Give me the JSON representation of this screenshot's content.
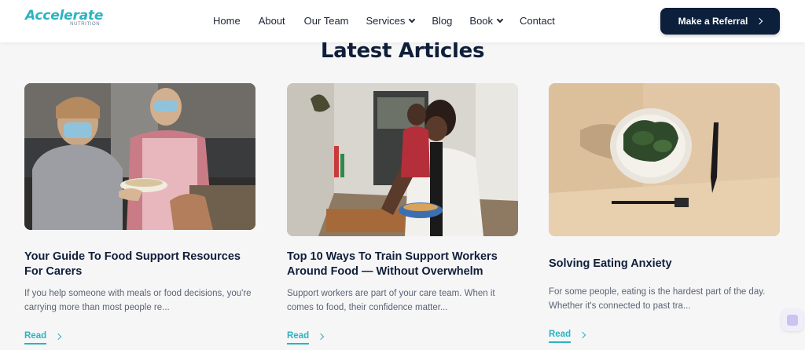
{
  "header": {
    "logo_text": "Accelerate",
    "logo_subtext": "NUTRITION",
    "nav": [
      {
        "label": "Home"
      },
      {
        "label": "About"
      },
      {
        "label": "Our Team"
      },
      {
        "label": "Services"
      },
      {
        "label": "Blog"
      },
      {
        "label": "Book"
      },
      {
        "label": "Contact"
      }
    ],
    "cta_label": "Make a Referral"
  },
  "section": {
    "title": "Latest Articles"
  },
  "articles": [
    {
      "title": "Your Guide To Food Support Resources For Carers",
      "excerpt": "If you help someone with meals or food decisions, you're carrying more than most people re...",
      "link": "Read"
    },
    {
      "title": "Top 10 Ways To Train Support Workers Around Food — Without Overwhelm",
      "excerpt": "Support workers are part of your care team. When it comes to food, their confidence matter...",
      "link": "Read"
    },
    {
      "title": "Solving Eating Anxiety",
      "excerpt": "For some people, eating is the hardest part of the day. Whether it's connected to past tra...",
      "link": "Read"
    }
  ],
  "colors": {
    "accent": "#2bb3c0",
    "navy": "#0c1f3b",
    "background": "#f6f6f7"
  }
}
